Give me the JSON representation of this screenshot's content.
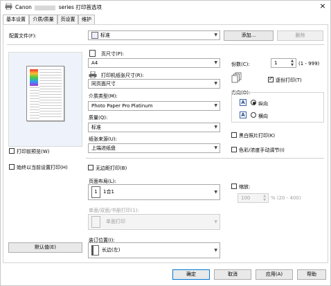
{
  "window": {
    "title_prefix": "Canon",
    "title_suffix": "series 打印首选项",
    "close": "×"
  },
  "tabs": [
    "基本设置",
    "介质/质量",
    "页设置",
    "维护"
  ],
  "profile": {
    "label": "配置文件(F):",
    "value": "标准",
    "add": "添加...",
    "delete": "删除"
  },
  "page_size": {
    "label": "页尺寸(P):",
    "value": "A4"
  },
  "printer_paper": {
    "label": "打印机纸张尺寸(R):",
    "value": "同页面尺寸"
  },
  "media": {
    "label": "介质类型(M):",
    "value": "Photo Paper Pro Platinum"
  },
  "quality": {
    "label": "质量(Q):",
    "value": "标准"
  },
  "paper_source": {
    "label": "纸张来源(U):",
    "value": "上端进纸盘"
  },
  "copies": {
    "label": "份数(C):",
    "value": "1",
    "range": "(1 - 999)"
  },
  "collate": {
    "label": "逐份打印(T)",
    "checked": true
  },
  "orientation": {
    "label": "方向(O):",
    "portrait": "纵向",
    "landscape": "横向",
    "icon": "A"
  },
  "grayscale": {
    "label": "黑白照片打印(K)"
  },
  "color_intensity": {
    "label": "色彩/浓度手动调节(I)"
  },
  "preview_before": {
    "label": "打印前预览(W)"
  },
  "always_current": {
    "label": "始终以当前设置打印(H)"
  },
  "borderless": {
    "label": "无边距打印(B)"
  },
  "page_layout": {
    "label": "页面布局(L):",
    "value": "1合1",
    "icon_text": "1"
  },
  "scaling": {
    "label": "缩放:",
    "value": "100",
    "range": "% (20 - 400)"
  },
  "duplex": {
    "label": "单面/双面/书册打印(1):",
    "value": "单面打印"
  },
  "binding": {
    "label": "装订位置(I):",
    "value": "长边(左)"
  },
  "defaults": {
    "label": "默认值(E)"
  },
  "footer": {
    "ok": "确定",
    "cancel": "取消",
    "apply": "应用(A)",
    "help": "帮助"
  }
}
